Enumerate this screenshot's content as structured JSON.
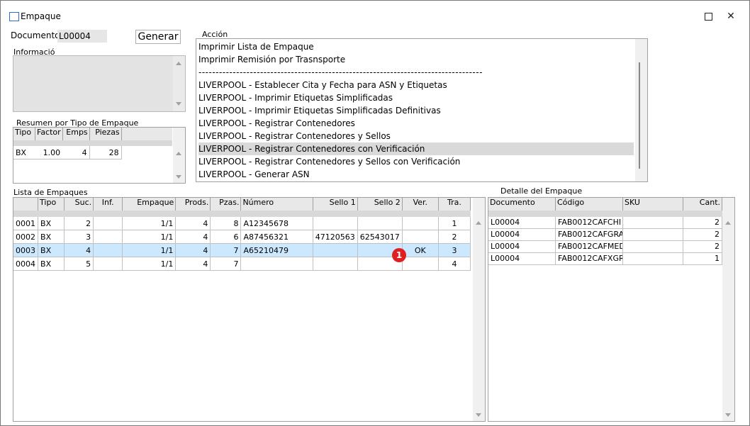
{
  "window": {
    "title": "Empaque"
  },
  "documento": {
    "label": "Documento:",
    "value": "L00004"
  },
  "generar_label": "Generar",
  "informacion": {
    "label": "Informació"
  },
  "accion": {
    "label": "Acción",
    "items": [
      "Imprimir Lista de Empaque",
      "Imprimir Remisión por Trasnsporte",
      "-----------------------------------------------------------------------------------",
      "LIVERPOOL - Establecer Cita y Fecha para ASN y Etiquetas",
      "LIVERPOOL - Imprimir Etiquetas Simplificadas",
      "LIVERPOOL - Imprimir Etiquetas Simplificadas Definitivas",
      "LIVERPOOL - Registrar Contenedores",
      "LIVERPOOL - Registrar Contenedores y Sellos",
      "LIVERPOOL - Registrar Contenedores con Verificación",
      "LIVERPOOL - Registrar Contenedores y Sellos con Verificación",
      "LIVERPOOL - Generar ASN"
    ],
    "selected_index": 8
  },
  "resumen": {
    "label": "Resumen por Tipo de Empaque",
    "headers": [
      "Tipo",
      "Factor",
      "Emps",
      "Piezas"
    ],
    "rows": [
      [
        "BX",
        "1.00",
        "4",
        "28"
      ]
    ]
  },
  "lista": {
    "label": "Lista de Empaques",
    "headers": [
      "Tipo",
      "Suc.",
      "Inf.",
      "Empaque",
      "Prods.",
      "Pzas.",
      "Número",
      "Sello 1",
      "Sello 2",
      "Ver.",
      "Tra."
    ],
    "rows": [
      [
        "0001",
        "BX",
        "2",
        "",
        "1/1",
        "4",
        "8",
        "A12345678",
        "",
        "",
        "",
        "1"
      ],
      [
        "0002",
        "BX",
        "3",
        "",
        "1/1",
        "4",
        "6",
        "A87456321",
        "47120563",
        "62543017",
        "",
        "2"
      ],
      [
        "0003",
        "BX",
        "4",
        "",
        "1/1",
        "4",
        "7",
        "A65210479",
        "",
        "",
        "OK",
        "3"
      ],
      [
        "0004",
        "BX",
        "5",
        "",
        "1/1",
        "4",
        "7",
        "",
        "",
        "",
        "",
        "4"
      ]
    ],
    "selected_row": 2
  },
  "detalle": {
    "label": "Detalle del Empaque",
    "headers": [
      "Documento",
      "Código",
      "SKU",
      "Cant."
    ],
    "rows": [
      [
        "L00004",
        "FAB0012CAFCHI",
        "",
        "2"
      ],
      [
        "L00004",
        "FAB0012CAFGRA",
        "",
        "2"
      ],
      [
        "L00004",
        "FAB0012CAFMED",
        "",
        "2"
      ],
      [
        "L00004",
        "FAB0012CAFXGR",
        "",
        "1"
      ]
    ]
  },
  "badge": "1",
  "colors": {
    "selection": "#cce8ff",
    "highlight": "#d9d9d9",
    "badge": "#e02020"
  }
}
